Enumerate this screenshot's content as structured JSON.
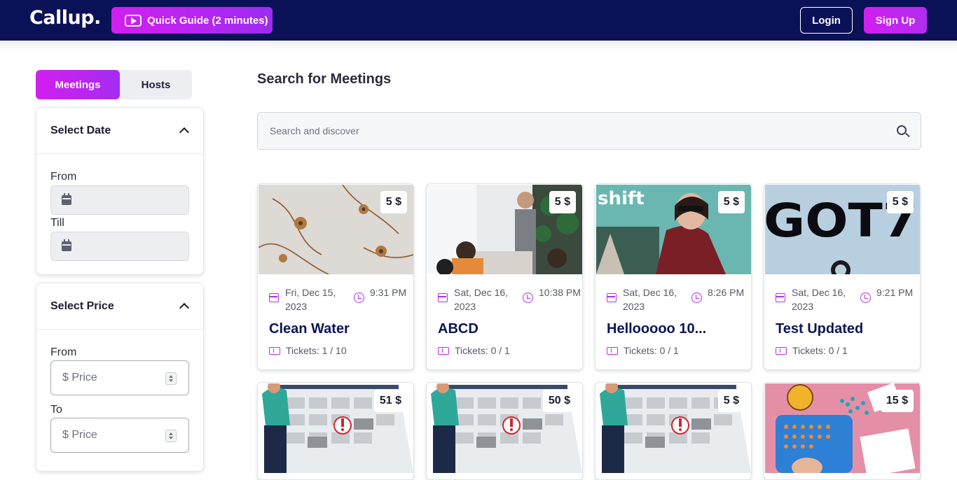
{
  "header": {
    "logo": "Callup.",
    "guide_label": "Quick Guide (2 minutes)",
    "login_label": "Login",
    "signup_label": "Sign Up"
  },
  "sidebar": {
    "tabs": [
      {
        "label": "Meetings",
        "active": true
      },
      {
        "label": "Hosts",
        "active": false
      }
    ],
    "date_filter": {
      "title": "Select Date",
      "from_label": "From",
      "till_label": "Till"
    },
    "price_filter": {
      "title": "Select Price",
      "from_label": "From",
      "to_label": "To",
      "placeholder": "$ Price"
    }
  },
  "main": {
    "title": "Search for Meetings",
    "search_placeholder": "Search and discover",
    "cards": [
      {
        "price": "5 $",
        "date": "Fri, Dec 15, 2023",
        "time": "9:31 PM",
        "title": "Clean Water",
        "tickets": "Tickets: 1 / 10",
        "image": "floral-wall"
      },
      {
        "price": "5 $",
        "date": "Sat, Dec 16, 2023",
        "time": "10:38 PM",
        "title": "ABCD",
        "tickets": "Tickets: 0 / 1",
        "image": "office-meeting"
      },
      {
        "price": "5 $",
        "date": "Sat, Dec 16, 2023",
        "time": "8:26 PM",
        "title": "Hellooooo 10...",
        "tickets": "Tickets: 0 / 1",
        "image": "shift-fashion",
        "image_text": "shift"
      },
      {
        "price": "5 $",
        "date": "Sat, Dec 16, 2023",
        "time": "9:21 PM",
        "title": "Test Updated",
        "tickets": "Tickets: 0 / 1",
        "image": "got7-logo",
        "image_text": "GOT7"
      },
      {
        "price": "51 $",
        "image": "calendar-illustration"
      },
      {
        "price": "50 $",
        "image": "calendar-illustration"
      },
      {
        "price": "5 $",
        "image": "calendar-illustration"
      },
      {
        "price": "15 $",
        "image": "bingo-game"
      }
    ]
  },
  "colors": {
    "header_bg": "#0b1157",
    "accent_gradient_start": "#d21ff0",
    "accent_gradient_end": "#9d2cf0",
    "icon_accent": "#b72cf0",
    "card_title": "#0e1456"
  }
}
